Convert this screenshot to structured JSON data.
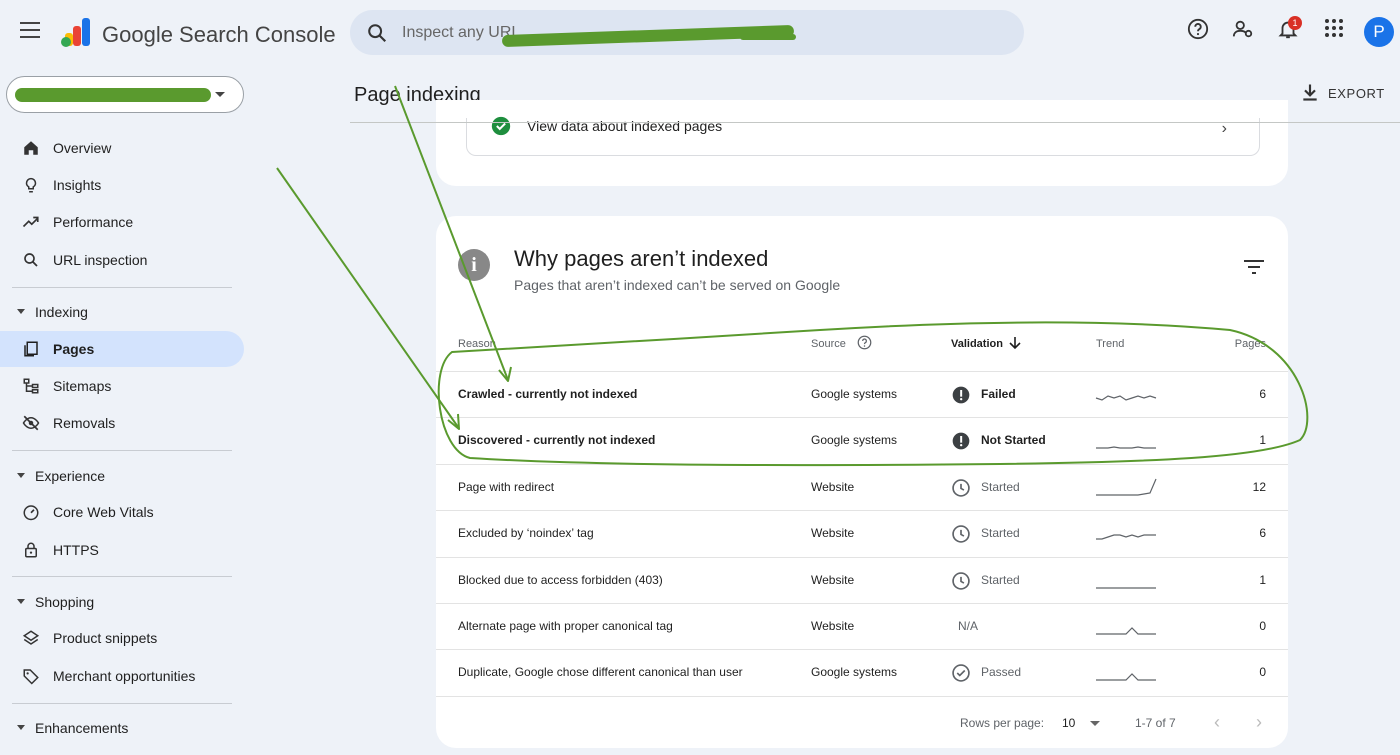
{
  "app": {
    "brand": "Google Search Console",
    "search_placeholder": "Inspect any URL",
    "notification_count": "1",
    "avatar_initial": "P"
  },
  "sidebar": {
    "items": [
      {
        "label": "Overview",
        "icon": "home-icon"
      },
      {
        "label": "Insights",
        "icon": "lightbulb-icon"
      },
      {
        "label": "Performance",
        "icon": "trending-up-icon"
      },
      {
        "label": "URL inspection",
        "icon": "search-icon"
      }
    ],
    "sections": [
      {
        "label": "Indexing",
        "items": [
          {
            "label": "Pages",
            "icon": "pages-icon",
            "active": true
          },
          {
            "label": "Sitemaps",
            "icon": "sitemap-icon"
          },
          {
            "label": "Removals",
            "icon": "eye-off-icon"
          }
        ]
      },
      {
        "label": "Experience",
        "items": [
          {
            "label": "Core Web Vitals",
            "icon": "speed-icon"
          },
          {
            "label": "HTTPS",
            "icon": "lock-icon"
          }
        ]
      },
      {
        "label": "Shopping",
        "items": [
          {
            "label": "Product snippets",
            "icon": "layers-icon"
          },
          {
            "label": "Merchant opportunities",
            "icon": "tag-icon"
          }
        ]
      },
      {
        "label": "Enhancements",
        "items": []
      }
    ]
  },
  "header": {
    "title": "Page indexing",
    "export_label": "EXPORT"
  },
  "indexed_card": {
    "label": "View data about indexed pages"
  },
  "why_card": {
    "title": "Why pages aren’t indexed",
    "subtitle": "Pages that aren’t indexed can’t be served on Google",
    "columns": {
      "reason": "Reason",
      "source": "Source",
      "validation": "Validation",
      "trend": "Trend",
      "pages": "Pages"
    },
    "rows": [
      {
        "reason": "Crawled - currently not indexed",
        "source": "Google systems",
        "validation": "Failed",
        "status": "error",
        "pages": "6",
        "trend": [
          3,
          2,
          4,
          3,
          4,
          2,
          3,
          4,
          3,
          4,
          3
        ]
      },
      {
        "reason": "Discovered - currently not indexed",
        "source": "Google systems",
        "validation": "Not Started",
        "status": "error",
        "pages": "1",
        "trend": [
          1,
          1,
          1,
          1.5,
          1,
          1,
          1,
          1.5,
          1,
          1,
          1
        ]
      },
      {
        "reason": "Page with redirect",
        "source": "Website",
        "validation": "Started",
        "status": "pending",
        "pages": "12",
        "trend": [
          1,
          1,
          1,
          1,
          1,
          1,
          1,
          1,
          1.5,
          2,
          9
        ]
      },
      {
        "reason": "Excluded by ‘noindex’ tag",
        "source": "Website",
        "validation": "Started",
        "status": "pending",
        "pages": "6",
        "trend": [
          2,
          2,
          3,
          4,
          4,
          3,
          4,
          3,
          4,
          4,
          4
        ]
      },
      {
        "reason": "Blocked due to access forbidden (403)",
        "source": "Website",
        "validation": "Started",
        "status": "pending",
        "pages": "1",
        "trend": [
          1,
          1,
          1,
          1,
          1,
          1,
          1,
          1,
          1,
          1,
          1
        ]
      },
      {
        "reason": "Alternate page with proper canonical tag",
        "source": "Website",
        "validation": "N/A",
        "status": "none",
        "pages": "0",
        "trend": [
          1,
          1,
          1,
          1,
          1,
          1,
          4,
          1,
          1,
          1,
          1
        ]
      },
      {
        "reason": "Duplicate, Google chose different canonical than user",
        "source": "Google systems",
        "validation": "Passed",
        "status": "passed",
        "pages": "0",
        "trend": [
          1,
          1,
          1,
          1,
          1,
          1,
          4,
          1,
          1,
          1,
          1
        ]
      }
    ],
    "footer": {
      "rows_per_page_label": "Rows per page:",
      "rows_per_page_value": "10",
      "range": "1-7 of 7"
    }
  },
  "colors": {
    "accent": "#1a73e8",
    "active_nav": "#d3e3fd",
    "annotation": "#5a9a2e",
    "success": "#1e8e3e"
  }
}
